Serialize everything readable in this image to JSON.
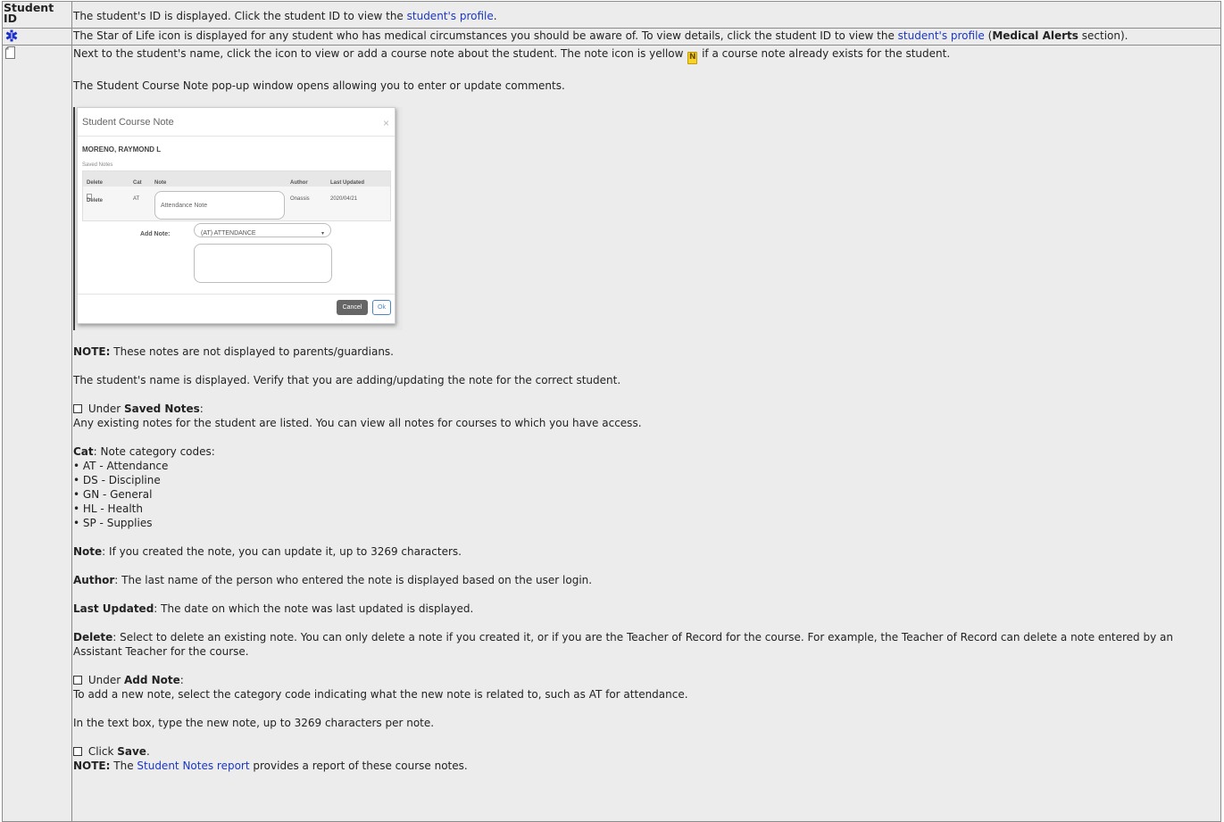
{
  "row1": {
    "header": "Student ID",
    "text_before": "The student's ID is displayed. Click the student ID to view the ",
    "link": "student's profile",
    "text_after": "."
  },
  "row2": {
    "icon": "star-of-life-icon",
    "icon_color": "#1b2fc9",
    "text_before": "The Star of Life icon is displayed for any student who has medical circumstances you should be aware of. To view details, click the student ID to view the ",
    "link": "student's profile",
    "text_mid": " (",
    "bold": "Medical Alerts",
    "text_after": " section)."
  },
  "row3": {
    "icon": "note-icon",
    "intro_before": "Next to the student's name, click the icon to view or add a course note about the student. The note icon is yellow ",
    "yellow_icon_letter": "N",
    "intro_after": " if a course note already exists for the student.",
    "popup_line": "The Student Course Note pop-up window opens allowing you to enter or update comments.",
    "modal": {
      "title": "Student Course Note",
      "close": "×",
      "student_name": "MORENO, RAYMOND L",
      "saved_label": "Saved Notes",
      "headers": [
        "Delete",
        "Cat",
        "Note",
        "Author",
        "Last Updated"
      ],
      "row": {
        "delete": "Delete",
        "cat": "AT",
        "note": "Attendance Note",
        "author": "Onassis",
        "updated": "2020/04/21"
      },
      "add_label": "Add Note:",
      "select_value": "(AT) ATTENDANCE",
      "select_arrow": "▾",
      "cancel": "Cancel",
      "ok": "Ok"
    },
    "note1_label": "NOTE:",
    "note1_text": " These notes are not displayed to parents/guardians.",
    "name_line": "The student's name is displayed. Verify that you are adding/updating the note for the correct student.",
    "saved_prefix": " Under ",
    "saved_bold": "Saved Notes",
    "saved_suffix": ":",
    "saved_desc": "Any existing notes for the student are listed. You can view all notes for courses to which you have access.",
    "cat_label": "Cat",
    "cat_text": ": Note category codes:",
    "cat_items": [
      "• AT - Attendance",
      "• DS - Discipline",
      "• GN - General",
      "• HL - Health",
      "• SP - Supplies"
    ],
    "note_label": "Note",
    "note_text": ": If you created the note, you can update it, up to 3269 characters.",
    "author_label": "Author",
    "author_text": ": The last name of the person who entered the note is displayed based on the user login.",
    "updated_label": "Last Updated",
    "updated_text": ": The date on which the note was last updated is displayed.",
    "delete_label": "Delete",
    "delete_text": ": Select to delete an existing note. You can only delete a note if you created it, or if you are the Teacher of Record for the course. For example, the Teacher of Record can delete a note entered by an Assistant Teacher for the course.",
    "add_prefix": " Under ",
    "add_bold": "Add Note",
    "add_suffix": ":",
    "add_desc": "To add a new note, select the category code indicating what the new note is related to, such as AT for attendance.",
    "textbox_line": "In the text box, type the new note, up to 3269 characters per note.",
    "click_prefix": " Click ",
    "click_bold": "Save",
    "click_suffix": ".",
    "final_label": "NOTE:",
    "final_before": " The ",
    "final_link": "Student Notes report",
    "final_after": " provides a report of these course notes."
  }
}
